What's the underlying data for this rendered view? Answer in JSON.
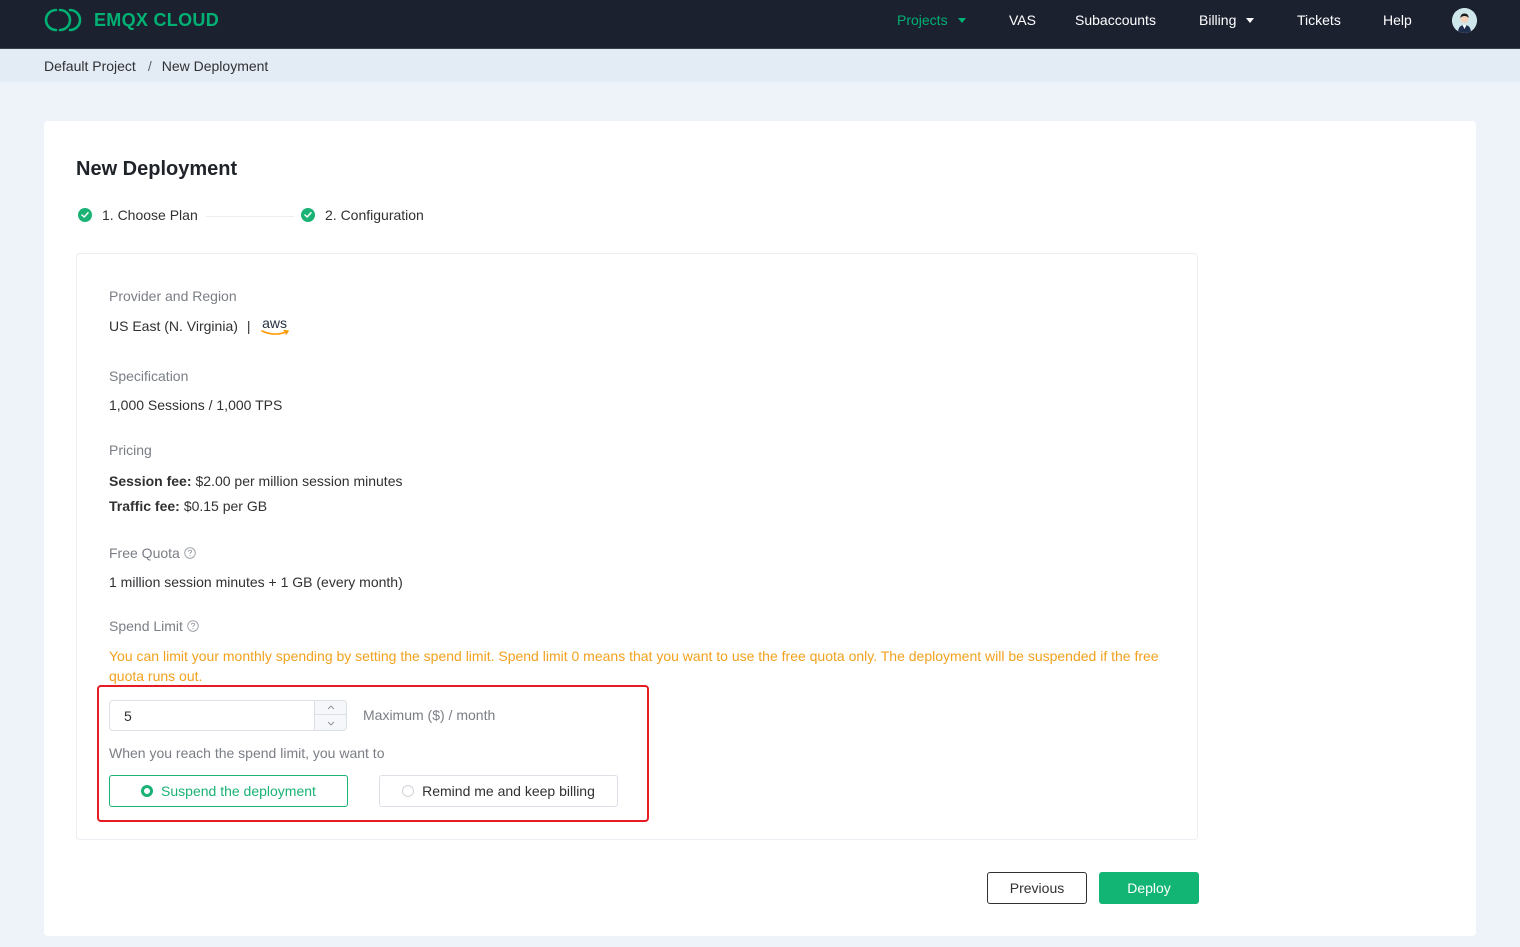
{
  "app": {
    "brand": "EMQX CLOUD",
    "colors": {
      "brand": "#00b173",
      "topbar": "#1c2130",
      "warning": "#f2a11e",
      "highlight_box": "#e51c23",
      "primary_button": "#13b574"
    }
  },
  "nav": {
    "items": [
      {
        "label": "Projects",
        "active": true,
        "has_dropdown": true
      },
      {
        "label": "VAS",
        "active": false,
        "has_dropdown": false
      },
      {
        "label": "Subaccounts",
        "active": false,
        "has_dropdown": false
      },
      {
        "label": "Billing",
        "active": false,
        "has_dropdown": true
      },
      {
        "label": "Tickets",
        "active": false,
        "has_dropdown": false
      },
      {
        "label": "Help",
        "active": false,
        "has_dropdown": false
      }
    ],
    "avatar_icon": "user-avatar"
  },
  "breadcrumb": {
    "items": [
      "Default Project",
      "New Deployment"
    ],
    "separator": "/"
  },
  "page": {
    "title": "New Deployment",
    "steps": [
      {
        "label": "1. Choose Plan",
        "status": "done"
      },
      {
        "label": "2. Configuration",
        "status": "done"
      }
    ]
  },
  "config": {
    "provider_region": {
      "label": "Provider and Region",
      "value": "US East (N. Virginia)",
      "separator": "|",
      "provider_logo": "aws"
    },
    "specification": {
      "label": "Specification",
      "value": "1,000 Sessions / 1,000 TPS"
    },
    "pricing": {
      "label": "Pricing",
      "session_fee_label": "Session fee:",
      "session_fee_value": "$2.00 per million session minutes",
      "traffic_fee_label": "Traffic fee:",
      "traffic_fee_value": "$0.15 per GB"
    },
    "free_quota": {
      "label": "Free Quota",
      "value": "1 million session minutes + 1 GB (every month)"
    },
    "spend_limit": {
      "label": "Spend Limit",
      "warning": "You can limit your monthly spending by setting the spend limit. Spend limit 0 means that you want to use the free quota only. The deployment will be suspended if the free quota runs out.",
      "input_value": "5",
      "unit": "Maximum ($) / month",
      "reach_prompt": "When you reach the spend limit, you want to",
      "options": [
        {
          "label": "Suspend the deployment",
          "selected": true
        },
        {
          "label": "Remind me and keep billing",
          "selected": false
        }
      ]
    }
  },
  "actions": {
    "previous": "Previous",
    "deploy": "Deploy"
  }
}
